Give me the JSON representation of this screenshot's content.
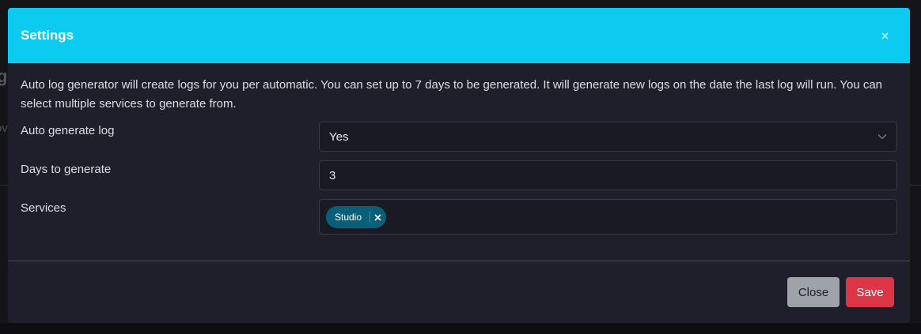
{
  "background": {
    "heading_fragment": "g",
    "text_fragment": "ov"
  },
  "modal": {
    "title": "Settings",
    "close_icon": "close-icon",
    "description": "Auto log generator will create logs for you per automatic. You can set up to 7 days to be generated. It will generate new logs on the date the last log will run. You can select multiple services to generate from.",
    "fields": {
      "auto_generate": {
        "label": "Auto generate log",
        "value": "Yes"
      },
      "days": {
        "label": "Days to generate",
        "value": "3"
      },
      "services": {
        "label": "Services",
        "tags": [
          "Studio"
        ]
      }
    },
    "footer": {
      "close_label": "Close",
      "save_label": "Save"
    }
  },
  "colors": {
    "header": "#0dcaf0",
    "modal_bg": "#1f1e2b",
    "tag": "#0a5f78",
    "close_button": "#9ea3a9",
    "save_button": "#dc3545"
  }
}
